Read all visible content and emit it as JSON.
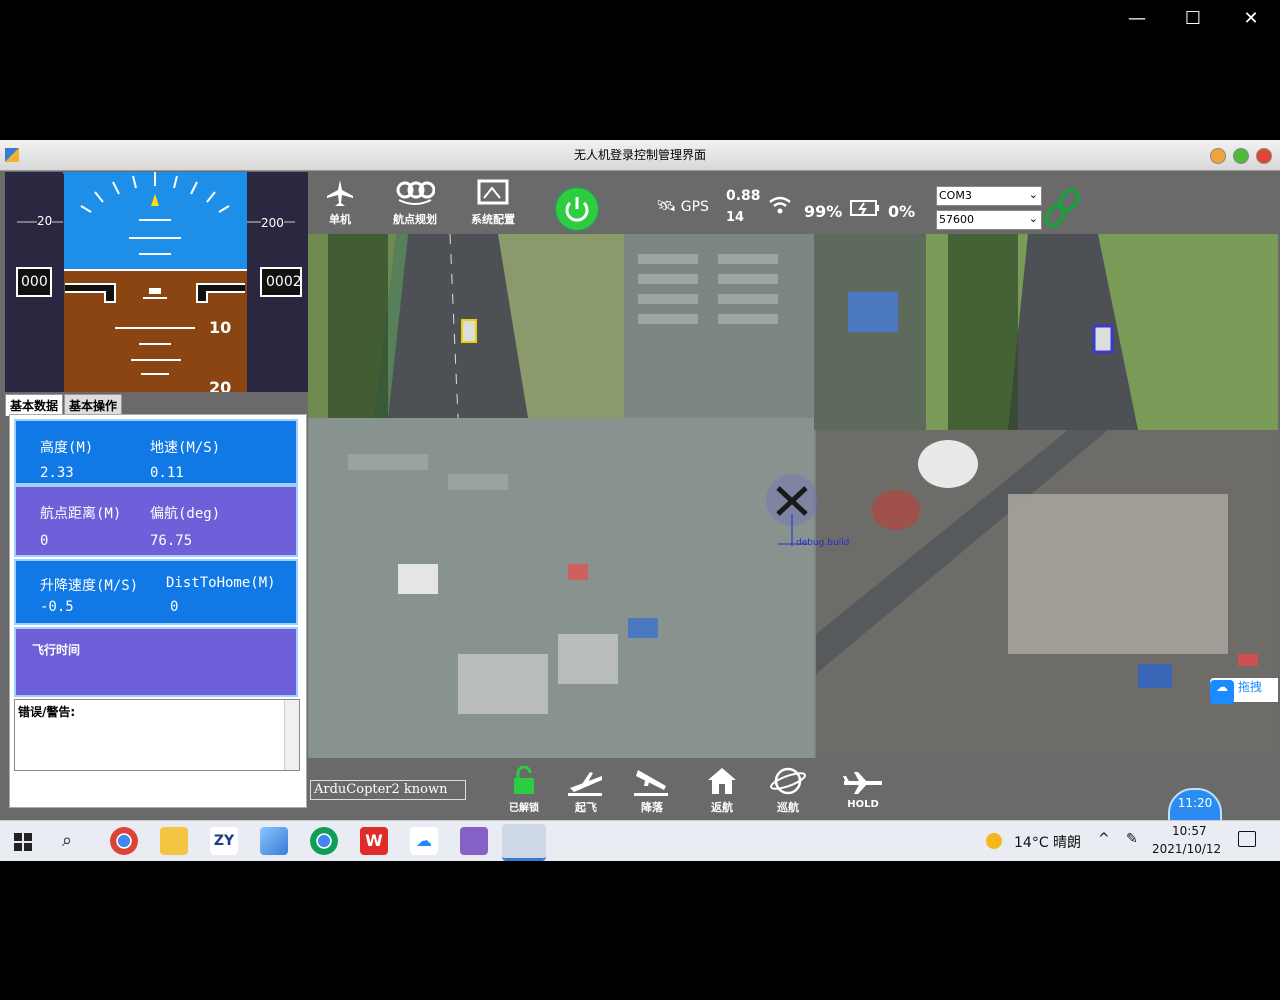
{
  "window": {
    "title": "无人机登录控制管理界面",
    "controls": [
      "—",
      "☐",
      "✕"
    ]
  },
  "hud": {
    "left_pitch_label": "20",
    "right_pitch_label": "200",
    "left_readout": "000",
    "right_readout": "0002",
    "scale_10": "10",
    "scale_20": "20"
  },
  "tabs": [
    "基本数据",
    "基本操作"
  ],
  "data": {
    "altitude_label": "高度(M)",
    "altitude_value": "2.33",
    "groundspeed_label": "地速(M/S)",
    "groundspeed_value": "0.11",
    "wp_dist_label": "航点距离(M)",
    "wp_dist_value": "0",
    "yaw_label": "偏航(deg)",
    "yaw_value": "76.75",
    "climb_label": "升降速度(M/S)",
    "climb_value": "-0.5",
    "dist_home_label": "DistToHome(M)",
    "dist_home_value": "0",
    "flight_time_label": "飞行时间",
    "warn_label": "错误/警告:"
  },
  "toolbar": {
    "single": "单机",
    "waypoint": "航点规划",
    "config": "系统配置",
    "gps_label": "GPS",
    "hdop": "0.88",
    "sats": "14",
    "signal": "99%",
    "battery": "0%",
    "port": "COM3",
    "baud": "57600"
  },
  "map": {
    "debug_label": "debug.build",
    "drag_label": "拖拽"
  },
  "bottom": {
    "status_field": "ArduCopter2 known",
    "unlocked": "已解锁",
    "takeoff": "起飞",
    "land": "降落",
    "rtl": "返航",
    "loiter": "巡航",
    "hold": "HOLD",
    "time_badge": "11:20"
  },
  "taskbar": {
    "weather": "14°C 晴朗",
    "time": "10:57",
    "date": "2021/10/12"
  },
  "colors": {
    "card_blue": "#1079e6",
    "card_purple": "#6e60d9",
    "power_green": "#2ecc40"
  }
}
